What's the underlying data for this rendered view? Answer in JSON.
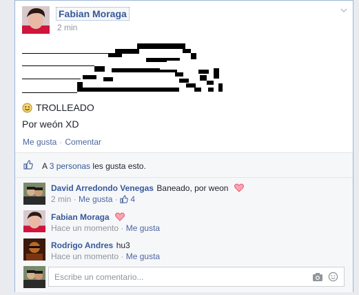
{
  "post": {
    "author": "Fabian Moraga",
    "time": "2 min",
    "line1": "TROLLEADO",
    "line2": "Por weón XD",
    "like_label": "Me gusta",
    "sep": "·",
    "comment_label": "Comentar"
  },
  "likes": {
    "prefix": "A",
    "link": "3 personas",
    "suffix": "les gusta esto."
  },
  "comments": [
    {
      "name": "David Arredondo Venegas",
      "text": "Baneado, por weon",
      "time": "2 min",
      "like": "Me gusta",
      "likes": "4"
    },
    {
      "name": "Fabian Moraga",
      "text": "",
      "time": "Hace un momento",
      "like": "Me gusta"
    },
    {
      "name": "Rodrigo Andres",
      "text": "hu3",
      "time": "Hace un momento",
      "like": "Me gusta"
    }
  ],
  "composer": {
    "placeholder": "Escribe un comentario..."
  },
  "colors": {
    "link": "#365899",
    "heart": "#f25268",
    "border": "#9cb4d8"
  }
}
